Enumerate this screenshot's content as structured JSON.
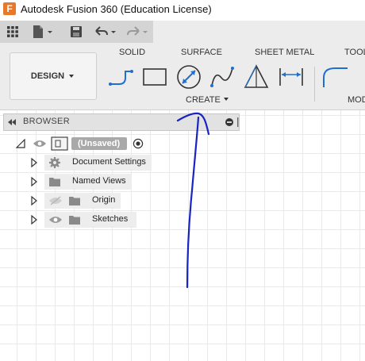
{
  "window": {
    "title": "Autodesk Fusion 360 (Education License)",
    "app_logo_letter": "F"
  },
  "qat": {
    "icons": [
      "grid-icon",
      "file-icon",
      "save-icon",
      "undo-icon",
      "redo-icon"
    ]
  },
  "ribbon": {
    "workspace_label": "DESIGN",
    "tabs": [
      "SOLID",
      "SURFACE",
      "SHEET METAL",
      "TOOL"
    ],
    "create_label": "CREATE",
    "modify_label": "MOD",
    "create_tools": [
      "line-tool-icon",
      "rectangle-tool-icon",
      "circle-tool-icon",
      "spline-tool-icon",
      "triangle-tool-icon",
      "dimension-tool-icon",
      "fillet-tool-icon"
    ]
  },
  "browser": {
    "title": "BROWSER",
    "root": {
      "label": "(Unsaved)"
    },
    "items": [
      {
        "label": "Document Settings",
        "icon": "gear-icon"
      },
      {
        "label": "Named Views",
        "icon": "folder-icon"
      },
      {
        "label": "Origin",
        "icon": "folder-icon"
      },
      {
        "label": "Sketches",
        "icon": "folder-icon"
      }
    ]
  },
  "colors": {
    "accent": "#e8792b",
    "ink": "#1a24c2",
    "ribbon_bg": "#ececec",
    "qat_bg": "#d4d4d4",
    "tool_blue": "#1e6fcf"
  }
}
